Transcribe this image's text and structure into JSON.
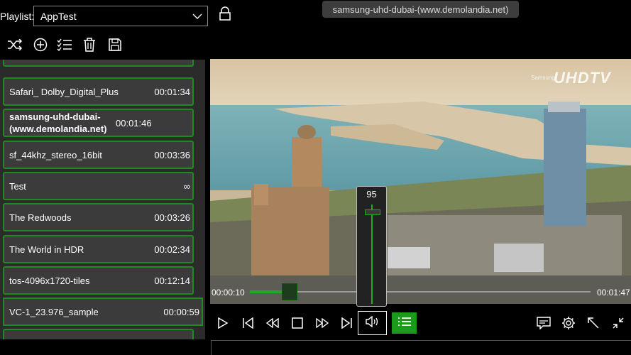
{
  "header": {
    "playlist_label": "Playlist:",
    "playlist_selected": "AppTest",
    "now_playing_title": "samsung-uhd-dubai-(www.demolandia.net)"
  },
  "toolbar": {
    "icons": [
      "shuffle-icon",
      "add-icon",
      "checklist-icon",
      "delete-icon",
      "save-icon"
    ]
  },
  "playlist": {
    "items": [
      {
        "name": "Safari_ Dolby_Digital_Plus",
        "duration": "00:01:34",
        "bold": false,
        "selected": false
      },
      {
        "name": "samsung-uhd-dubai-(www.demolandia.net)",
        "duration": "00:01:46",
        "bold": true,
        "selected": false
      },
      {
        "name": "sf_44khz_stereo_16bit",
        "duration": "00:03:36",
        "bold": false,
        "selected": false
      },
      {
        "name": "Test",
        "duration": "∞",
        "bold": false,
        "selected": false
      },
      {
        "name": "The Redwoods",
        "duration": "00:03:26",
        "bold": false,
        "selected": false
      },
      {
        "name": "The World in HDR",
        "duration": "00:02:34",
        "bold": false,
        "selected": false
      },
      {
        "name": "tos-4096x1720-tiles",
        "duration": "00:12:14",
        "bold": false,
        "selected": false
      },
      {
        "name": "VC-1_23.976_sample",
        "duration": "00:00:59",
        "bold": false,
        "selected": true
      }
    ]
  },
  "video": {
    "watermark_brand": "Samsung",
    "watermark_logo": "UHDTV"
  },
  "player": {
    "elapsed": "00:00:10",
    "total": "00:01:47",
    "progress_fraction": 0.093,
    "volume": "95",
    "volume_fraction": 0.95
  },
  "colors": {
    "accent": "#1c9a1c",
    "item_border": "#1f8a1f",
    "panel_bg": "#2b2b2b",
    "item_bg": "#3b3b3b"
  }
}
